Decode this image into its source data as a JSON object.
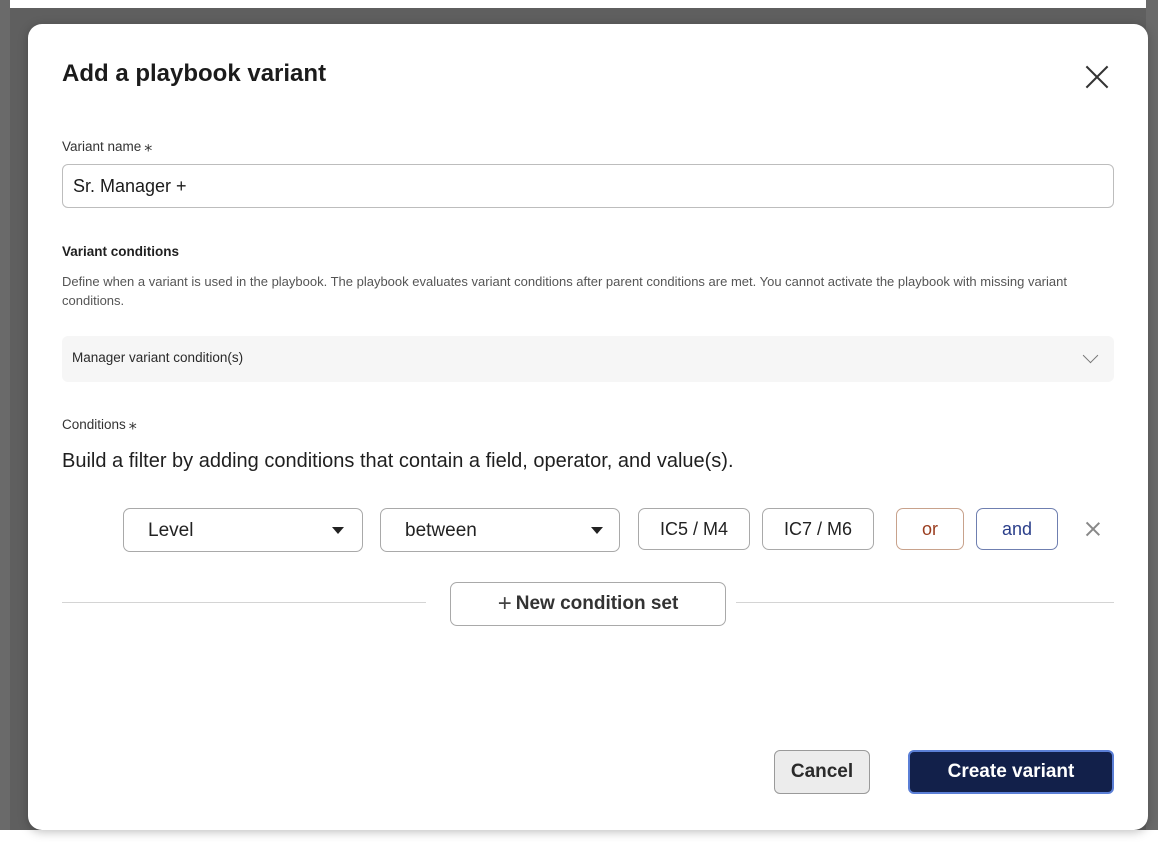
{
  "modal": {
    "title": "Add a playbook variant"
  },
  "variant_name": {
    "label": "Variant name",
    "required_marker": "⁎",
    "value": "Sr. Manager +"
  },
  "variant_conditions": {
    "title": "Variant conditions",
    "description": "Define when a variant is used in the playbook. The playbook evaluates variant conditions after parent conditions are met. You cannot activate the playbook with missing variant conditions.",
    "select_label": "Manager variant condition(s)"
  },
  "conditions": {
    "label": "Conditions",
    "required_marker": "⁎",
    "helper": "Build a filter by adding conditions that contain a field, operator, and value(s).",
    "row": {
      "field": "Level",
      "operator": "between",
      "values": [
        "IC5 / M4",
        "IC7 / M6"
      ],
      "or_label": "or",
      "and_label": "and"
    },
    "new_set_label": "New condition set"
  },
  "footer": {
    "cancel_label": "Cancel",
    "create_label": "Create variant"
  },
  "colors": {
    "primary_button": "#12204a",
    "or_text": "#9a3d1f",
    "and_text": "#2a3e8a"
  }
}
